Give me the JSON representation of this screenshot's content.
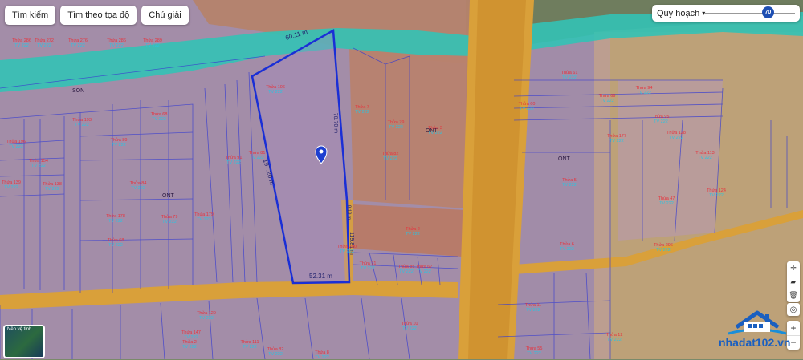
{
  "toolbar": {
    "search": "Tìm kiếm",
    "coords": "Tìm theo tọa độ",
    "legend": "Chú giải"
  },
  "planning": {
    "label": "Quy hoạch",
    "opacity": 70
  },
  "map": {
    "edges": {
      "top": "60.11 m",
      "right": "70.70 m",
      "left": "197.20 m",
      "right_lower": "119.81 m",
      "right_small": "9.19 m",
      "bottom": "52.31 m"
    },
    "zone_labels": [
      "ONT",
      "ONT",
      "ONT",
      "SON"
    ],
    "parcels": [
      {
        "a": "Thửa 286",
        "b": "TV 222"
      },
      {
        "a": "Thửa 272",
        "b": "TV 222"
      },
      {
        "a": "Thửa 276",
        "b": "TV 222"
      },
      {
        "a": "Thửa 286",
        "b": "TV 222"
      },
      {
        "a": "Thửa 289",
        "b": "TV 222"
      },
      {
        "a": "Thửa 80",
        "b": "TV 222"
      },
      {
        "a": "Thửa 193",
        "b": "TV 222"
      },
      {
        "a": "Thửa 89",
        "b": "TV 222"
      },
      {
        "a": "Thửa 68",
        "b": "TV 222"
      },
      {
        "a": "Thửa 196",
        "b": "TV 222"
      },
      {
        "a": "Thửa 154",
        "b": "TV 222"
      },
      {
        "a": "Thửa 139",
        "b": "TV 222"
      },
      {
        "a": "Thửa 138",
        "b": "TV 222"
      },
      {
        "a": "Thửa 84",
        "b": "TV 222"
      },
      {
        "a": "Thửa 91",
        "b": "TV 222"
      },
      {
        "a": "Thửa 81",
        "b": "TV 222"
      },
      {
        "a": "Thửa 79",
        "b": "TV 222"
      },
      {
        "a": "Thửa 178",
        "b": "TV 222"
      },
      {
        "a": "Thửa 179",
        "b": "TV 222"
      },
      {
        "a": "Thửa 68",
        "b": "TV 222"
      },
      {
        "a": "Thửa 106",
        "b": "TV 222"
      },
      {
        "a": "Thửa 7",
        "b": "TV 222"
      },
      {
        "a": "Thửa 82",
        "b": "TV 222"
      },
      {
        "a": "Thửa 3",
        "b": "TV 222"
      },
      {
        "a": "Thửa 79",
        "b": "TV 222"
      },
      {
        "a": "Thửa 71",
        "b": "TV 222"
      },
      {
        "a": "Thửa 85",
        "b": "TV 222"
      },
      {
        "a": "Thửa 67",
        "b": "TV 222"
      },
      {
        "a": "Thửa 290",
        "b": "TV 222"
      },
      {
        "a": "Thửa 2",
        "b": "TV 222"
      },
      {
        "a": "Thửa 61",
        "b": "TV 222"
      },
      {
        "a": "Thửa 60",
        "b": "TV 222"
      },
      {
        "a": "Thửa 69",
        "b": "TV 222"
      },
      {
        "a": "Thửa 94",
        "b": "TV 222"
      },
      {
        "a": "Thửa 95",
        "b": "TV 222"
      },
      {
        "a": "Thửa 177",
        "b": "TV 222"
      },
      {
        "a": "Thửa 128",
        "b": "TV 222"
      },
      {
        "a": "Thửa 113",
        "b": "TV 222"
      },
      {
        "a": "Thửa 124",
        "b": "TV 222"
      },
      {
        "a": "Thửa 5",
        "b": "TV 222"
      },
      {
        "a": "Thửa 6",
        "b": "TV 222"
      },
      {
        "a": "Thửa 47",
        "b": "TV 222"
      },
      {
        "a": "Thửa 296",
        "b": "TV 222"
      },
      {
        "a": "Thửa 129",
        "b": "TV 222"
      },
      {
        "a": "Thửa 147",
        "b": "TV 222"
      },
      {
        "a": "Thửa 2",
        "b": "TV 222"
      },
      {
        "a": "Thửa 111",
        "b": "TV 222"
      },
      {
        "a": "Thửa 82",
        "b": "TV 222"
      },
      {
        "a": "Thửa 10",
        "b": "TV 222"
      },
      {
        "a": "Thửa 11",
        "b": "TV 222"
      },
      {
        "a": "Thửa 12",
        "b": "TV 222"
      },
      {
        "a": "Thửa 55",
        "b": "TV 222"
      },
      {
        "a": "Thửa 8",
        "b": "TV 222"
      }
    ]
  },
  "minimap": {
    "label": "Nền vệ tinh"
  },
  "brand": {
    "name": "nhadat102.vn"
  },
  "colors": {
    "boundary": "#1a2fd6",
    "cyan_zone": "#33c2b5",
    "road": "#d9a03a",
    "marker": "#1e3fd0"
  },
  "icons": [
    "search-icon",
    "crosshair-icon",
    "ruler-icon",
    "trash-icon",
    "target-icon",
    "plus-icon",
    "minus-icon",
    "chevron-down-icon",
    "map-pin-icon",
    "house-logo-icon"
  ]
}
